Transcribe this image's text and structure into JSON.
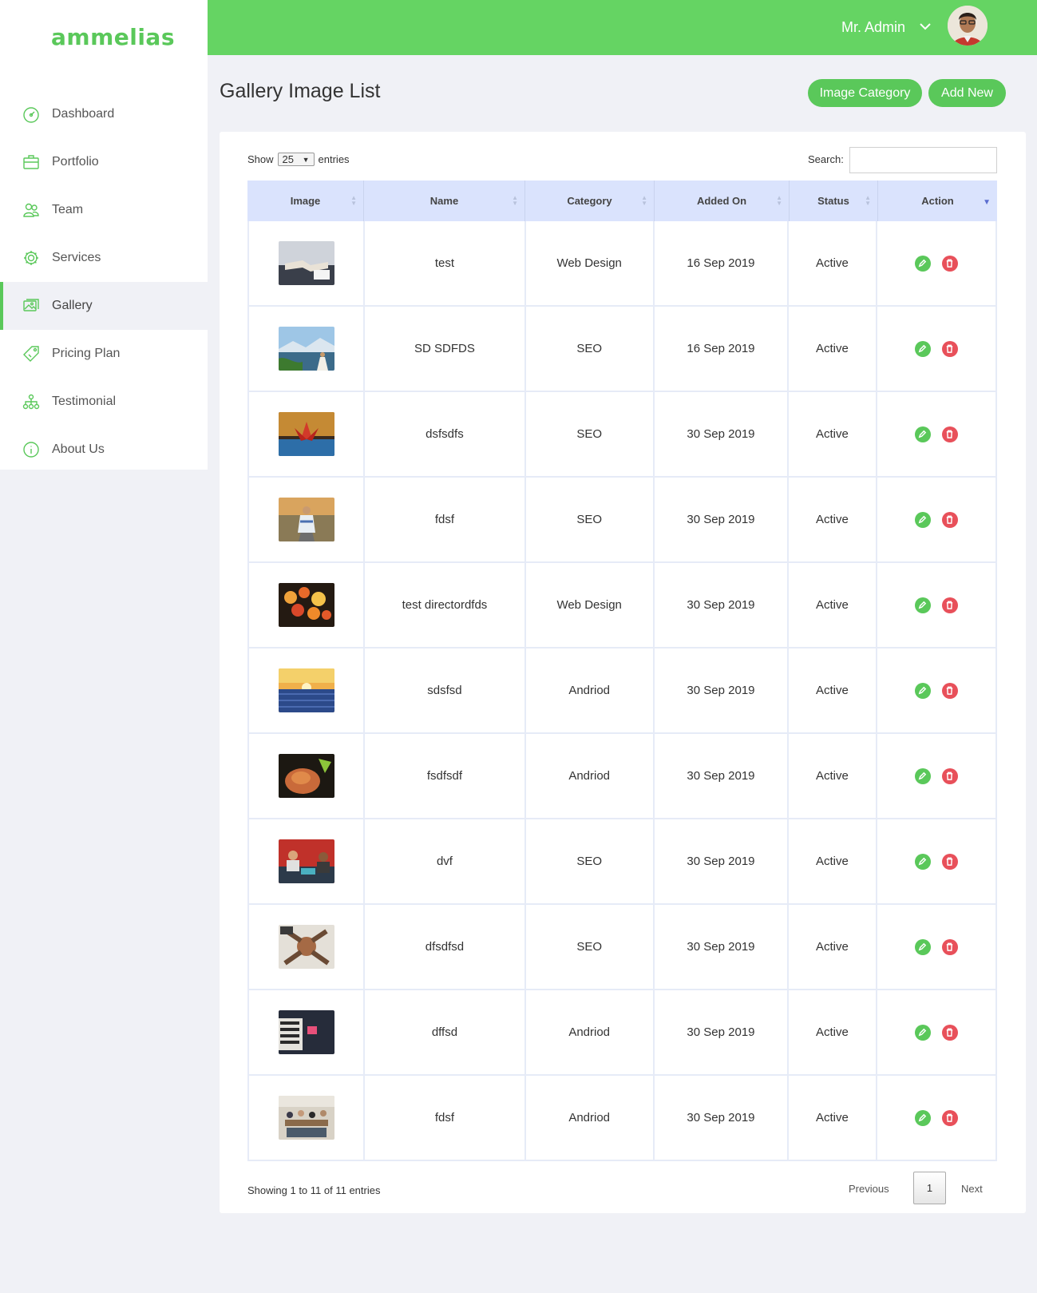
{
  "brand": {
    "logo_text": "ammelias",
    "accent_color": "#5ac85a",
    "danger_color": "#e8505a"
  },
  "sidebar": {
    "items": [
      {
        "label": "Dashboard",
        "icon": "speedometer-icon"
      },
      {
        "label": "Portfolio",
        "icon": "briefcase-icon"
      },
      {
        "label": "Team",
        "icon": "team-icon"
      },
      {
        "label": "Services",
        "icon": "gear-icon"
      },
      {
        "label": "Gallery",
        "icon": "gallery-icon",
        "active": true
      },
      {
        "label": "Pricing Plan",
        "icon": "price-tag-icon"
      },
      {
        "label": "Testimonial",
        "icon": "network-icon"
      },
      {
        "label": "About Us",
        "icon": "info-icon"
      }
    ]
  },
  "topbar": {
    "user_name": "Mr. Admin"
  },
  "page": {
    "title": "Gallery Image List",
    "image_category_button": "Image Category",
    "add_new_button": "Add New"
  },
  "table_controls": {
    "show_label": "Show",
    "entries_value": "25",
    "entries_label": "entries",
    "search_label": "Search:",
    "search_value": ""
  },
  "table": {
    "columns": [
      "Image",
      "Name",
      "Category",
      "Added On",
      "Status",
      "Action"
    ],
    "rows": [
      {
        "name": "test",
        "category": "Web Design",
        "added_on": "16 Sep 2019",
        "status": "Active",
        "thumb": "handshake"
      },
      {
        "name": "SD SDFDS",
        "category": "SEO",
        "added_on": "16 Sep 2019",
        "status": "Active",
        "thumb": "coast"
      },
      {
        "name": "dsfsdfs",
        "category": "SEO",
        "added_on": "30 Sep 2019",
        "status": "Active",
        "thumb": "lotus"
      },
      {
        "name": "fdsf",
        "category": "SEO",
        "added_on": "30 Sep 2019",
        "status": "Active",
        "thumb": "road"
      },
      {
        "name": "test directordfds",
        "category": "Web Design",
        "added_on": "30 Sep 2019",
        "status": "Active",
        "thumb": "flowers"
      },
      {
        "name": "sdsfsd",
        "category": "Andriod",
        "added_on": "30 Sep 2019",
        "status": "Active",
        "thumb": "sunset"
      },
      {
        "name": "fsdfsdf",
        "category": "Andriod",
        "added_on": "30 Sep 2019",
        "status": "Active",
        "thumb": "food"
      },
      {
        "name": "dvf",
        "category": "SEO",
        "added_on": "30 Sep 2019",
        "status": "Active",
        "thumb": "office"
      },
      {
        "name": "dfsdfsd",
        "category": "SEO",
        "added_on": "30 Sep 2019",
        "status": "Active",
        "thumb": "hands"
      },
      {
        "name": "dffsd",
        "category": "Andriod",
        "added_on": "30 Sep 2019",
        "status": "Active",
        "thumb": "book"
      },
      {
        "name": "fdsf",
        "category": "Andriod",
        "added_on": "30 Sep 2019",
        "status": "Active",
        "thumb": "meeting"
      }
    ]
  },
  "pagination": {
    "info": "Showing 1 to 11 of 11 entries",
    "previous": "Previous",
    "current_page": "1",
    "next": "Next"
  }
}
